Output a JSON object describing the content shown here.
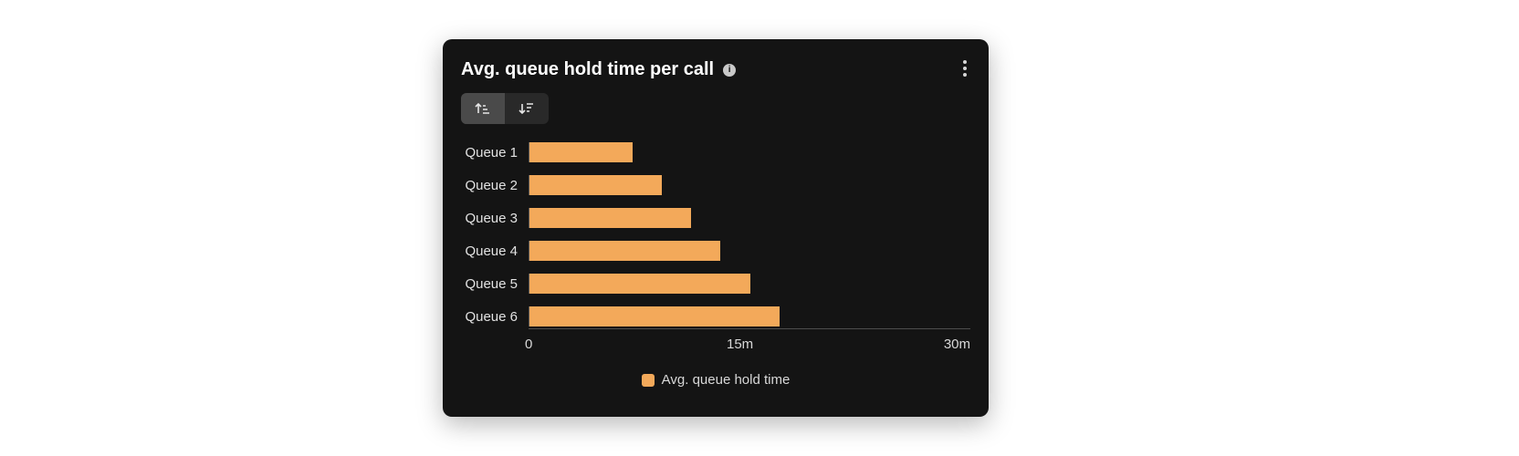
{
  "card": {
    "title": "Avg. queue hold time per call",
    "info_glyph": "i"
  },
  "sort": {
    "asc_active": true,
    "desc_active": false
  },
  "legend": {
    "label": "Avg. queue hold time"
  },
  "axis": {
    "ticks": [
      "0",
      "15m",
      "30m"
    ]
  },
  "colors": {
    "bar": "#f3a95a",
    "card_bg": "#141414"
  },
  "chart_data": {
    "type": "bar",
    "orientation": "horizontal",
    "title": "Avg. queue hold time per call",
    "xlabel": "",
    "ylabel": "",
    "xlim": [
      0,
      30
    ],
    "x_unit": "minutes",
    "categories": [
      "Queue 1",
      "Queue 2",
      "Queue 3",
      "Queue 4",
      "Queue 5",
      "Queue 6"
    ],
    "values": [
      7,
      9,
      11,
      13,
      15,
      17
    ],
    "legend": [
      "Avg. queue hold time"
    ],
    "x_ticks": [
      0,
      15,
      30
    ],
    "x_tick_labels": [
      "0",
      "15m",
      "30m"
    ]
  }
}
